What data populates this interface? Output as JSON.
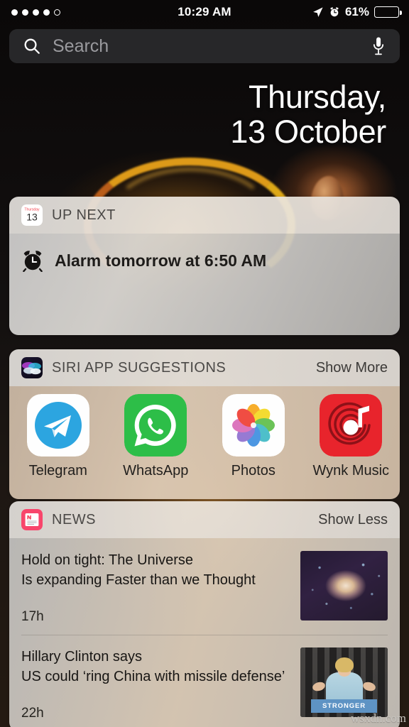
{
  "status_bar": {
    "signal_dots_filled": 4,
    "signal_dots_total": 5,
    "time": "10:29 AM",
    "battery_percent": "61%",
    "battery_level": 61,
    "icons": [
      "location-arrow-icon",
      "alarm-icon",
      "battery-icon"
    ]
  },
  "search": {
    "placeholder": "Search",
    "value": "",
    "icons": [
      "search-icon",
      "microphone-icon"
    ]
  },
  "date_header": {
    "weekday": "Thursday,",
    "day_month": "13 October"
  },
  "widgets": [
    {
      "id": "up-next",
      "icon": "calendar-icon",
      "icon_weekday": "Thursday",
      "icon_day": "13",
      "title": "UP NEXT",
      "action": "",
      "event_icon": "alarm-clock-icon",
      "event_text": "Alarm tomorrow at 6:50 AM"
    },
    {
      "id": "siri-app-suggestions",
      "icon": "siri-icon",
      "title": "SIRI APP SUGGESTIONS",
      "action": "Show More",
      "apps": [
        {
          "name": "Telegram",
          "icon": "telegram-icon",
          "color": "#2CA5E0"
        },
        {
          "name": "WhatsApp",
          "icon": "whatsapp-icon",
          "color": "#2DBE48"
        },
        {
          "name": "Photos",
          "icon": "photos-icon",
          "color": "#FFFFFF"
        },
        {
          "name": "Wynk Music",
          "icon": "wynk-music-icon",
          "color": "#E8242C"
        }
      ]
    },
    {
      "id": "news",
      "icon": "news-icon",
      "title": "NEWS",
      "action": "Show Less",
      "stories": [
        {
          "title": "Hold on tight: The Universe\nIs expanding Faster than we Thought",
          "time": "17h",
          "thumbnail": "galaxy-photo"
        },
        {
          "title": "Hillary Clinton says\nUS could ‘ring China with missile defense’",
          "time": "22h",
          "thumbnail": "hillary-clinton-podium-photo",
          "thumbnail_banner_text": "STRONGER"
        }
      ]
    }
  ],
  "watermark": "wsxdn.com",
  "colors": {
    "background": "#0a0808",
    "search_field": "#2a2a2c",
    "widget_light": "#e2dfdb",
    "news_accent": "#F8456B"
  }
}
